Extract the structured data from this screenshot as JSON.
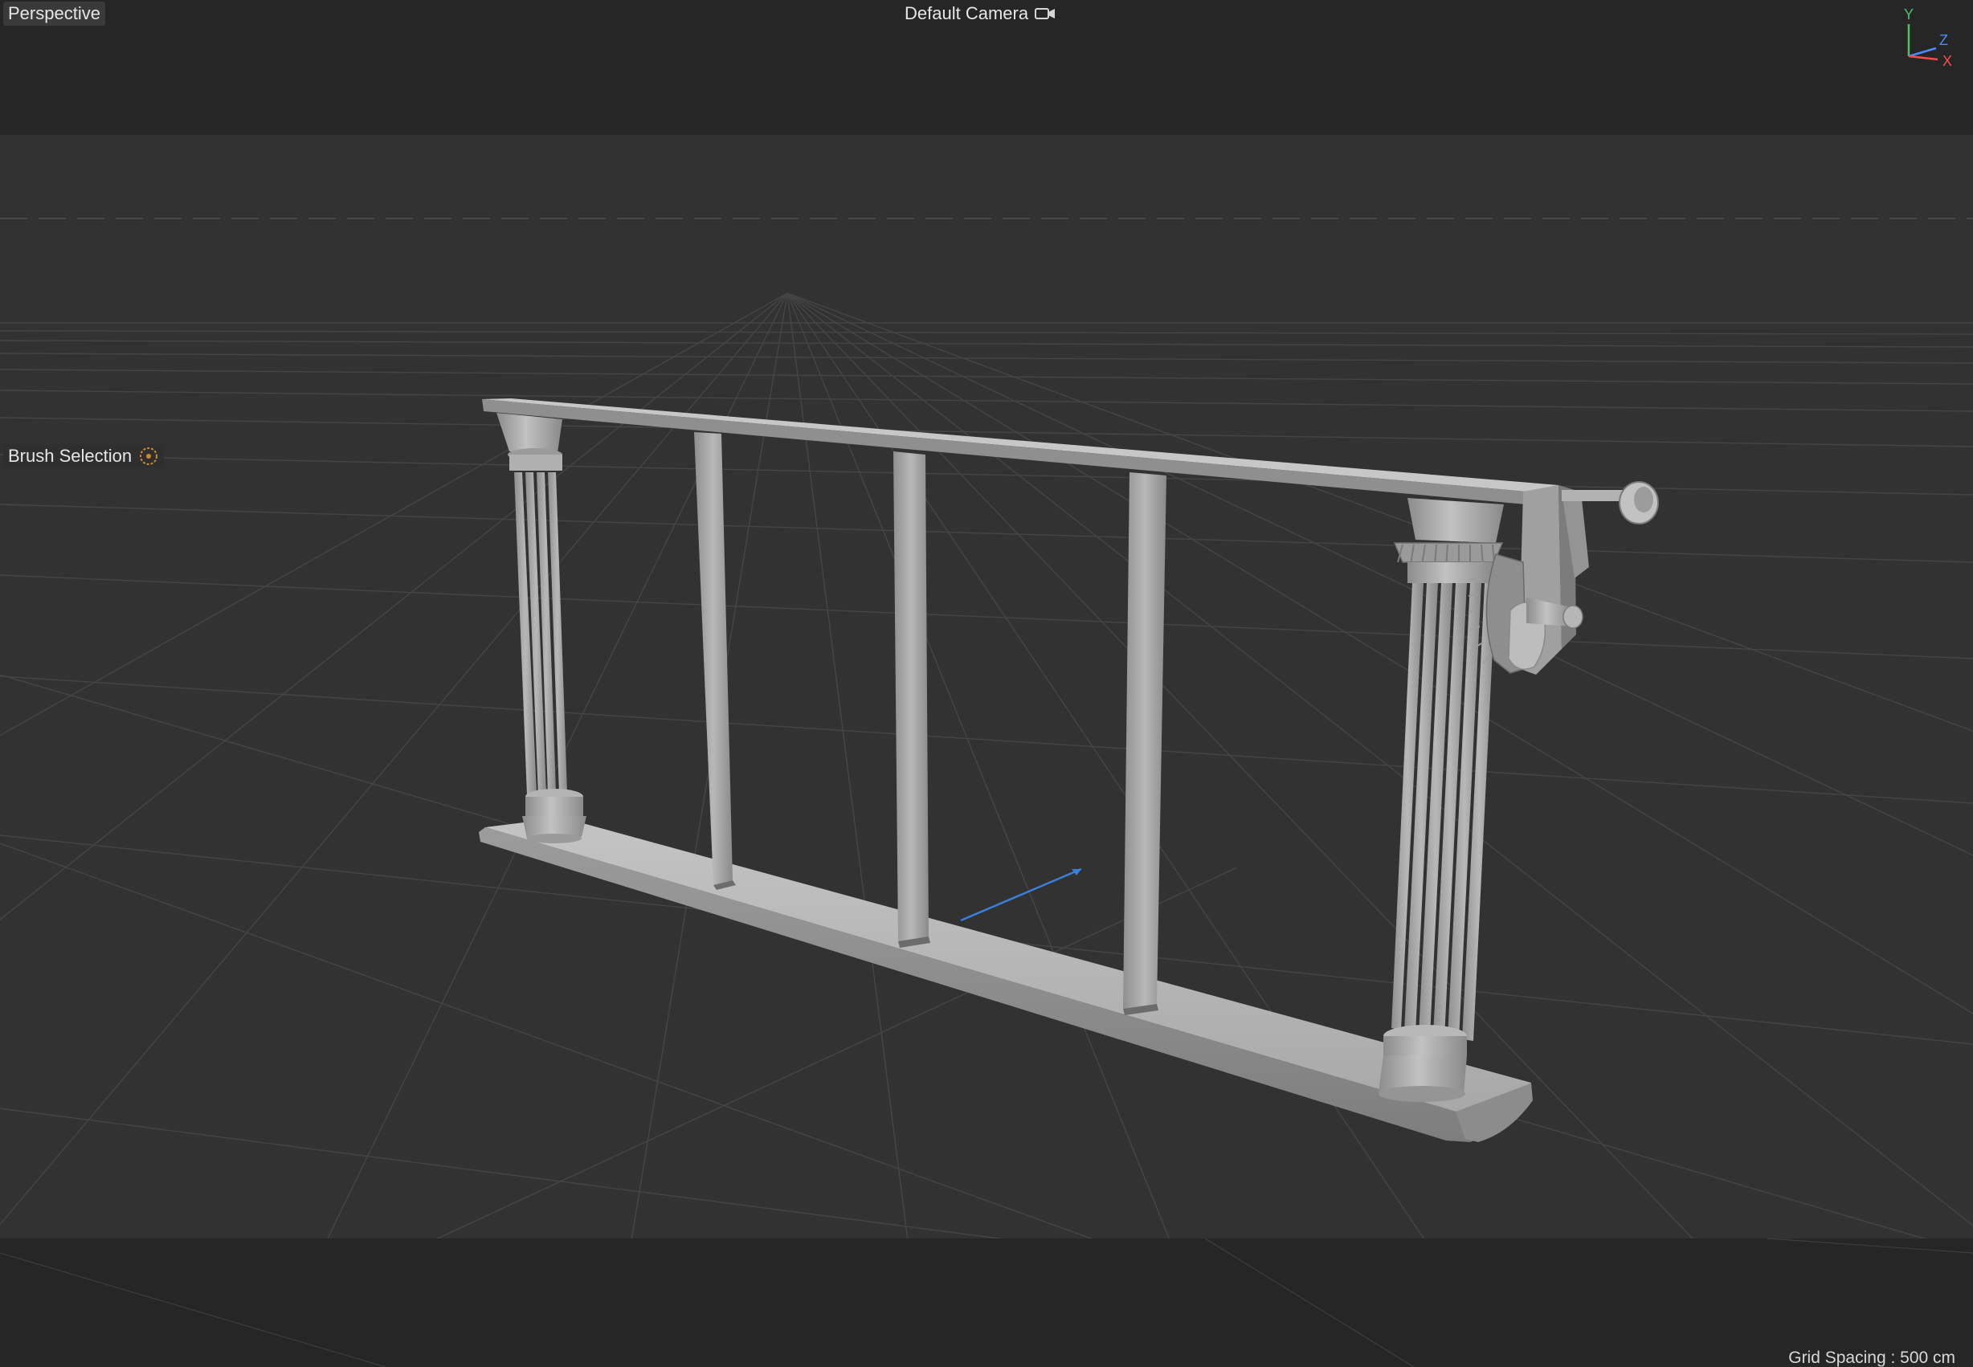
{
  "viewport": {
    "view_mode": "Perspective",
    "camera": "Default Camera",
    "camera_icon": "camera-icon",
    "tool_label": "Brush Selection",
    "tool_icon": "brush-target-icon",
    "grid_spacing": "Grid Spacing : 500 cm"
  },
  "axis_gizmo": {
    "y": "Y",
    "z": "Z",
    "x": "X",
    "colors": {
      "y": "#4cc36a",
      "z": "#4a8cff",
      "x": "#ff4a4a"
    }
  },
  "colors": {
    "background": "#262626",
    "floor": "#323232",
    "model": "#a4a4a4",
    "accent_axis": "#3a7fd9"
  }
}
